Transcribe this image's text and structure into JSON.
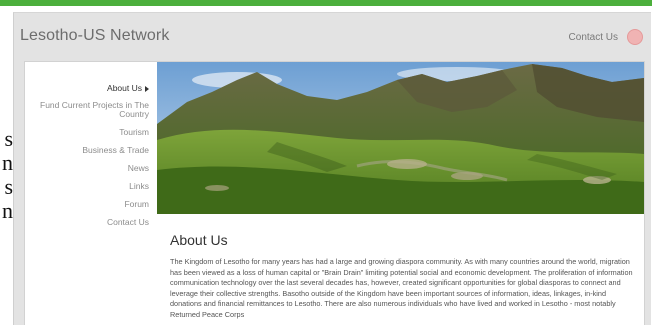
{
  "header": {
    "site_title": "Lesotho-US Network",
    "contact_label": "Contact Us"
  },
  "left_fragments": [
    "s",
    "n",
    "s",
    "n"
  ],
  "sidebar": {
    "items": [
      {
        "label": "About Us",
        "active": true
      },
      {
        "label": "Fund Current Projects in The Country",
        "active": false
      },
      {
        "label": "Tourism",
        "active": false
      },
      {
        "label": "Business & Trade",
        "active": false
      },
      {
        "label": "News",
        "active": false
      },
      {
        "label": "Links",
        "active": false
      },
      {
        "label": "Forum",
        "active": false
      },
      {
        "label": "Contact Us",
        "active": false
      }
    ]
  },
  "main": {
    "title": "About Us",
    "paragraph": "The Kingdom of Lesotho for many years has had a large and growing diaspora community.  As with many countries around the world, migration has been viewed as a loss of human capital or \"Brain Drain\" limiting potential social and economic development.  The proliferation of information communication technology over the last several decades has, however, created significant opportunities for global diasporas to connect and leverage their collective strengths.  Basotho outside of the Kingdom have been important sources of information, ideas, linkages, in-kind donations and financial remittances to Lesotho.  There are also numerous individuals who have lived and worked in Lesotho - most notably Returned Peace Corps"
  },
  "colors": {
    "top_rule": "#4caf3c",
    "frame_bg": "#e3e3e3",
    "contact_icon": "#f0b3b3"
  }
}
